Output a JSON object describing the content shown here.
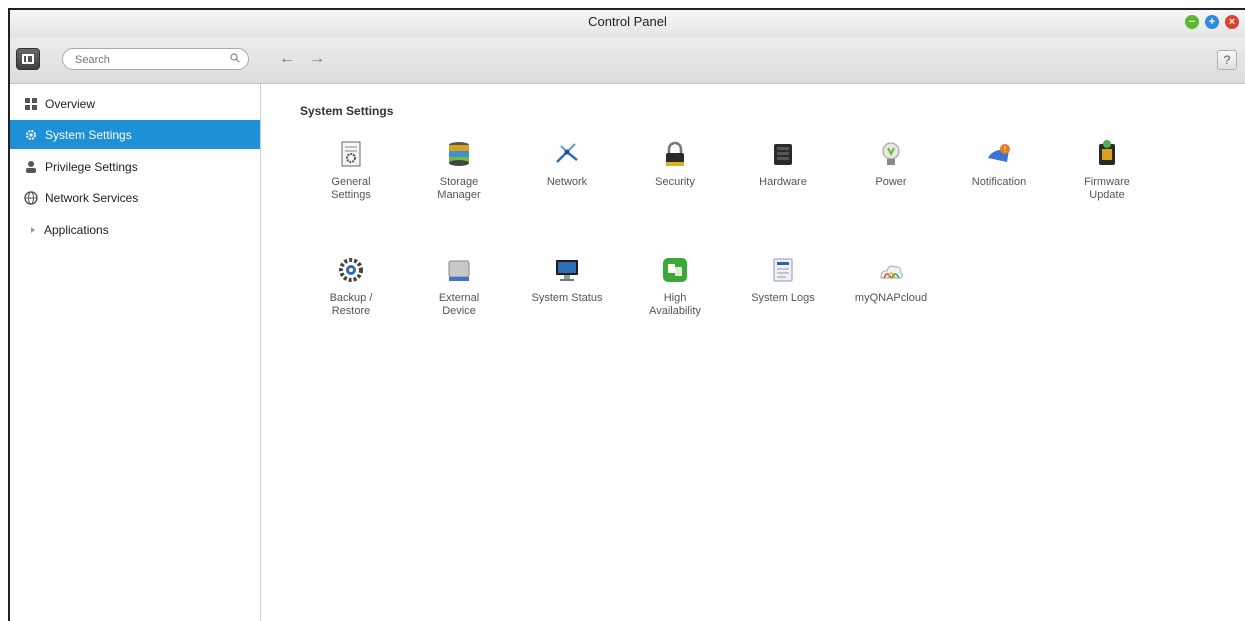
{
  "window": {
    "title": "Control Panel"
  },
  "window_controls": {
    "minimize": "−",
    "maximize": "+",
    "close": "×"
  },
  "toolbar": {
    "search_placeholder": "Search",
    "back": "←",
    "forward": "→",
    "help": "?"
  },
  "sidebar": {
    "items": [
      {
        "label": "Overview",
        "icon": "overview-icon",
        "active": false
      },
      {
        "label": "System Settings",
        "icon": "gear-icon",
        "active": true
      },
      {
        "label": "Privilege Settings",
        "icon": "user-icon",
        "active": false
      },
      {
        "label": "Network Services",
        "icon": "network-services-icon",
        "active": false
      },
      {
        "label": "Applications",
        "icon": "expand-arrow-icon",
        "active": false
      }
    ]
  },
  "main": {
    "section_title": "System Settings",
    "tiles": [
      {
        "label_1": "General",
        "label_2": "Settings",
        "icon": "general-settings-icon"
      },
      {
        "label_1": "Storage",
        "label_2": "Manager",
        "icon": "storage-manager-icon"
      },
      {
        "label_1": "Network",
        "label_2": "",
        "icon": "network-icon"
      },
      {
        "label_1": "Security",
        "label_2": "",
        "icon": "lock-icon"
      },
      {
        "label_1": "Hardware",
        "label_2": "",
        "icon": "hardware-icon"
      },
      {
        "label_1": "Power",
        "label_2": "",
        "icon": "power-bulb-icon"
      },
      {
        "label_1": "Notification",
        "label_2": "",
        "icon": "notification-icon"
      },
      {
        "label_1": "Firmware",
        "label_2": "Update",
        "icon": "firmware-update-icon"
      },
      {
        "label_1": "Backup /",
        "label_2": "Restore",
        "icon": "backup-restore-icon"
      },
      {
        "label_1": "External",
        "label_2": "Device",
        "icon": "external-device-icon"
      },
      {
        "label_1": "System Status",
        "label_2": "",
        "icon": "monitor-icon"
      },
      {
        "label_1": "High",
        "label_2": "Availability",
        "icon": "high-availability-icon"
      },
      {
        "label_1": "System Logs",
        "label_2": "",
        "icon": "logs-icon"
      },
      {
        "label_1": "myQNAPcloud",
        "label_2": "",
        "icon": "cloud-icon"
      }
    ]
  },
  "colors": {
    "accent": "#1e90d8",
    "sidebar_border": "#cfcfcf"
  }
}
